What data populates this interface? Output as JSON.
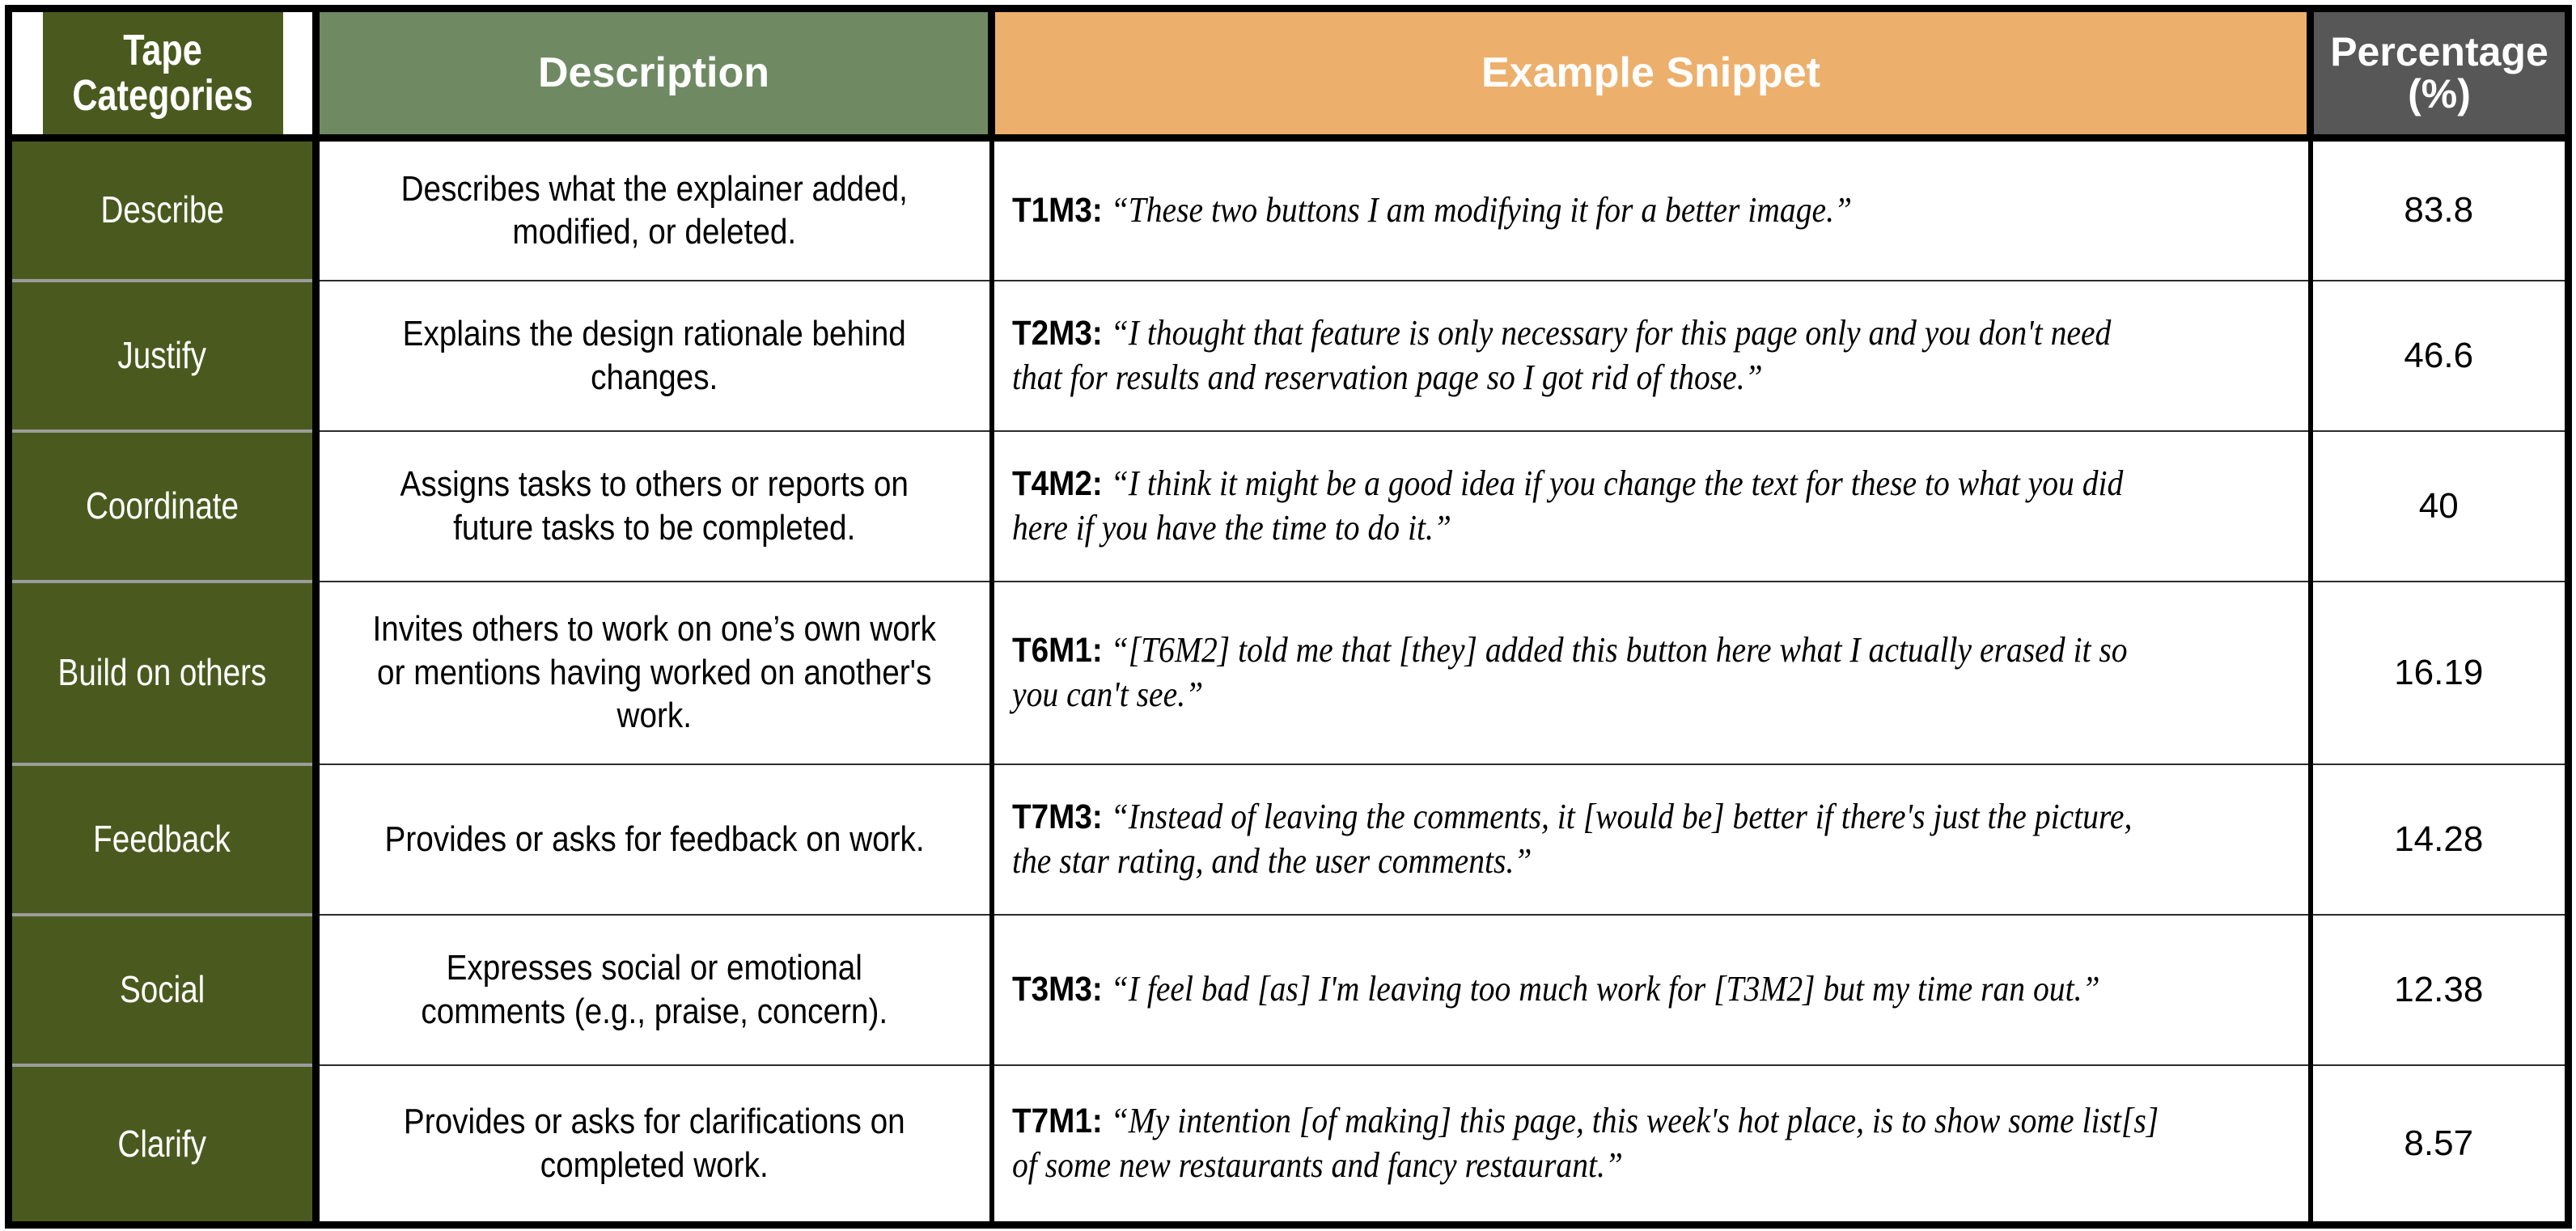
{
  "table": {
    "headers": {
      "category": "Tape\nCategories",
      "category_line1": "Tape",
      "category_line2": "Categories",
      "description": "Description",
      "snippet": "Example Snippet",
      "percentage_line1": "Percentage",
      "percentage_line2": "(%)"
    },
    "colors": {
      "category_header_bg": "#4A5A1F",
      "description_header_bg": "#6F8A63",
      "snippet_header_bg": "#ECB06C",
      "percentage_header_bg": "#575757",
      "category_cell_bg": "#4A5A1F",
      "header_text": "#FFFFFF",
      "body_text": "#000000",
      "border": "#000000",
      "row_divider": "#9C9C9C"
    },
    "rows": [
      {
        "category": "Describe",
        "description": "Describes what the explainer added, modified, or deleted.",
        "speaker": "T1M3:",
        "quote": "“These two buttons I am modifying it for a better image.”",
        "percentage": "83.8"
      },
      {
        "category": "Justify",
        "description": "Explains the design rationale behind changes.",
        "speaker": "T2M3:",
        "quote": "“I thought that feature is only necessary for this page only and you don't need that for results and reservation page so I got rid of those.”",
        "percentage": "46.6"
      },
      {
        "category": "Coordinate",
        "description": "Assigns tasks to others or reports on future tasks to be completed.",
        "speaker": "T4M2:",
        "quote": "“I think it might be a good idea if you change the text for these to what you did here if you have the time to do it.”",
        "percentage": "40"
      },
      {
        "category": "Build on others",
        "description": "Invites others to work on one’s own work or mentions having worked on another's work.",
        "speaker": "T6M1:",
        "quote": "“[T6M2] told me that [they] added this button here what I actually erased it so you can't see.”",
        "percentage": "16.19"
      },
      {
        "category": "Feedback",
        "description": "Provides or asks for feedback on work.",
        "speaker": "T7M3:",
        "quote": "“Instead of leaving the comments, it [would be] better if there's just the picture, the star rating, and the user comments.”",
        "percentage": "14.28"
      },
      {
        "category": "Social",
        "description": "Expresses social or emotional comments (e.g., praise, concern).",
        "speaker": "T3M3:",
        "quote": "“I feel bad [as] I'm leaving too much work for [T3M2] but my time ran out.”",
        "percentage": "12.38"
      },
      {
        "category": "Clarify",
        "description": "Provides or asks for clarifications on completed work.",
        "speaker": "T7M1:",
        "quote": "“My intention [of making] this page, this week's hot place, is to show some list[s] of some new restaurants and fancy restaurant.”",
        "percentage": "8.57"
      }
    ]
  }
}
